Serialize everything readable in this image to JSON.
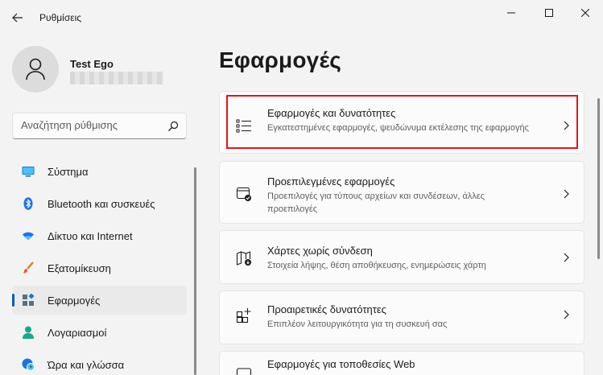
{
  "window": {
    "app_title": "Ρυθμίσεις"
  },
  "profile": {
    "name": "Test Ego"
  },
  "search": {
    "placeholder": "Αναζήτηση ρύθμισης"
  },
  "sidebar": {
    "items": [
      {
        "label": "Σύστημα",
        "icon": "system-display-icon",
        "active": false
      },
      {
        "label": "Bluetooth και συσκευές",
        "icon": "bluetooth-icon",
        "active": false
      },
      {
        "label": "Δίκτυο και Internet",
        "icon": "wifi-icon",
        "active": false
      },
      {
        "label": "Εξατομίκευση",
        "icon": "paintbrush-icon",
        "active": false
      },
      {
        "label": "Εφαρμογές",
        "icon": "apps-icon",
        "active": true
      },
      {
        "label": "Λογαριασμοί",
        "icon": "person-icon",
        "active": false
      },
      {
        "label": "Ώρα και γλώσσα",
        "icon": "globe-clock-icon",
        "active": false
      }
    ]
  },
  "main": {
    "title": "Εφαρμογές",
    "cards": [
      {
        "title": "Εφαρμογές και δυνατότητες",
        "subtitle": "Εγκατεστημένες εφαρμογές, ψευδώνυμα εκτέλεσης της εφαρμογής",
        "icon": "app-list-icon",
        "highlighted": true
      },
      {
        "title": "Προεπιλεγμένες εφαρμογές",
        "subtitle": "Προεπιλογές για τύπους αρχείων και συνδέσεων, άλλες προεπιλογές",
        "icon": "default-apps-icon",
        "highlighted": false
      },
      {
        "title": "Χάρτες χωρίς σύνδεση",
        "subtitle": "Στοιχεία λήψης, θέση αποθήκευσης, ενημερώσεις χάρτη",
        "icon": "offline-map-icon",
        "highlighted": false
      },
      {
        "title": "Προαιρετικές δυνατότητες",
        "subtitle": "Επιπλέον λειτουργικότητα για τη συσκευή σας",
        "icon": "optional-features-icon",
        "highlighted": false
      },
      {
        "title": "Εφαρμογές για τοποθεσίες Web",
        "subtitle": "",
        "icon": "websites-apps-icon",
        "highlighted": false
      }
    ]
  },
  "colors": {
    "accent": "#005fb8",
    "highlight_border": "#e0161c",
    "background": "#f3f3f3",
    "card": "#fbfbfb"
  }
}
